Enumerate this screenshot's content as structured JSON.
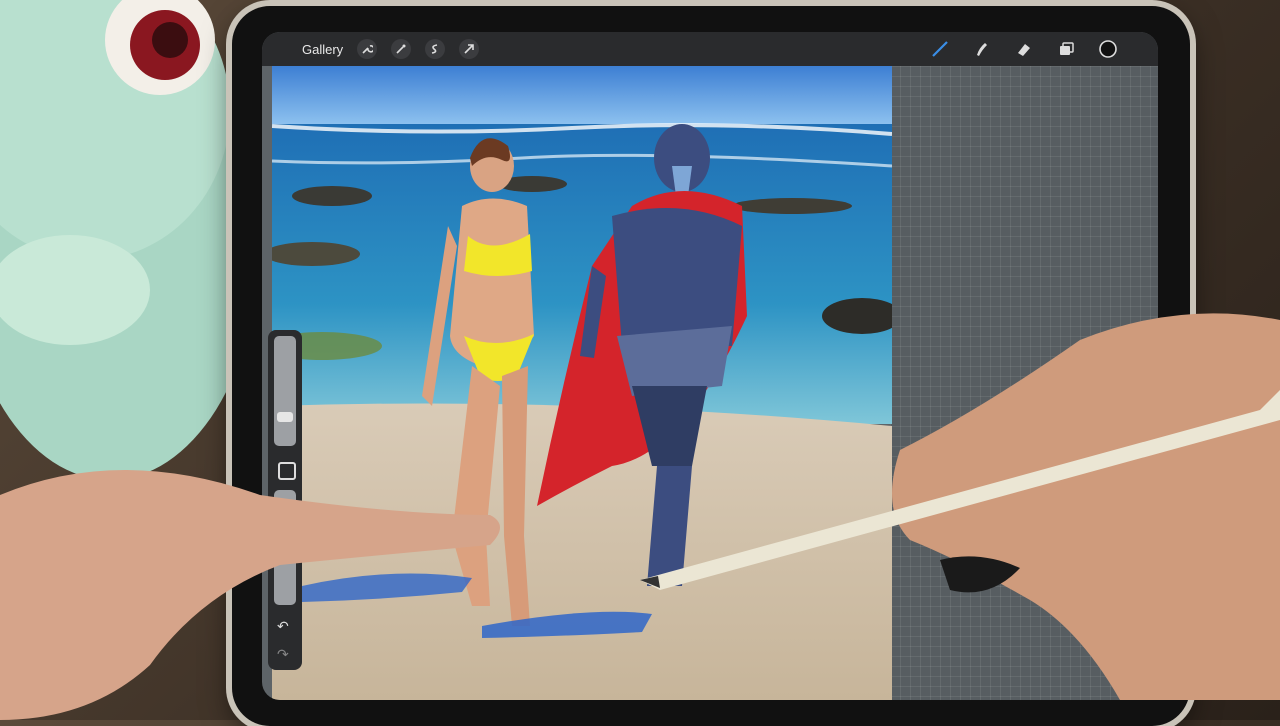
{
  "toolbar": {
    "gallery_label": "Gallery",
    "left_tools": [
      {
        "icon": "wrench-icon"
      },
      {
        "icon": "magic-wand-icon"
      },
      {
        "icon": "selection-icon"
      },
      {
        "icon": "transform-arrow-icon"
      }
    ],
    "right_tools": [
      {
        "icon": "brush-icon",
        "active_color": "#3a8ee6"
      },
      {
        "icon": "smudge-icon"
      },
      {
        "icon": "eraser-icon"
      },
      {
        "icon": "layers-icon"
      },
      {
        "icon": "color-circle-icon"
      }
    ]
  },
  "sidebar": {
    "tools": [
      "brush-size-slider",
      "modify-button",
      "opacity-slider",
      "undo-icon",
      "redo-icon"
    ]
  },
  "colors": {
    "armor": "#3c4d80",
    "cape": "#d4242b",
    "bikini": "#f2e62a",
    "toolbar_bg": "#2a2b2d"
  }
}
